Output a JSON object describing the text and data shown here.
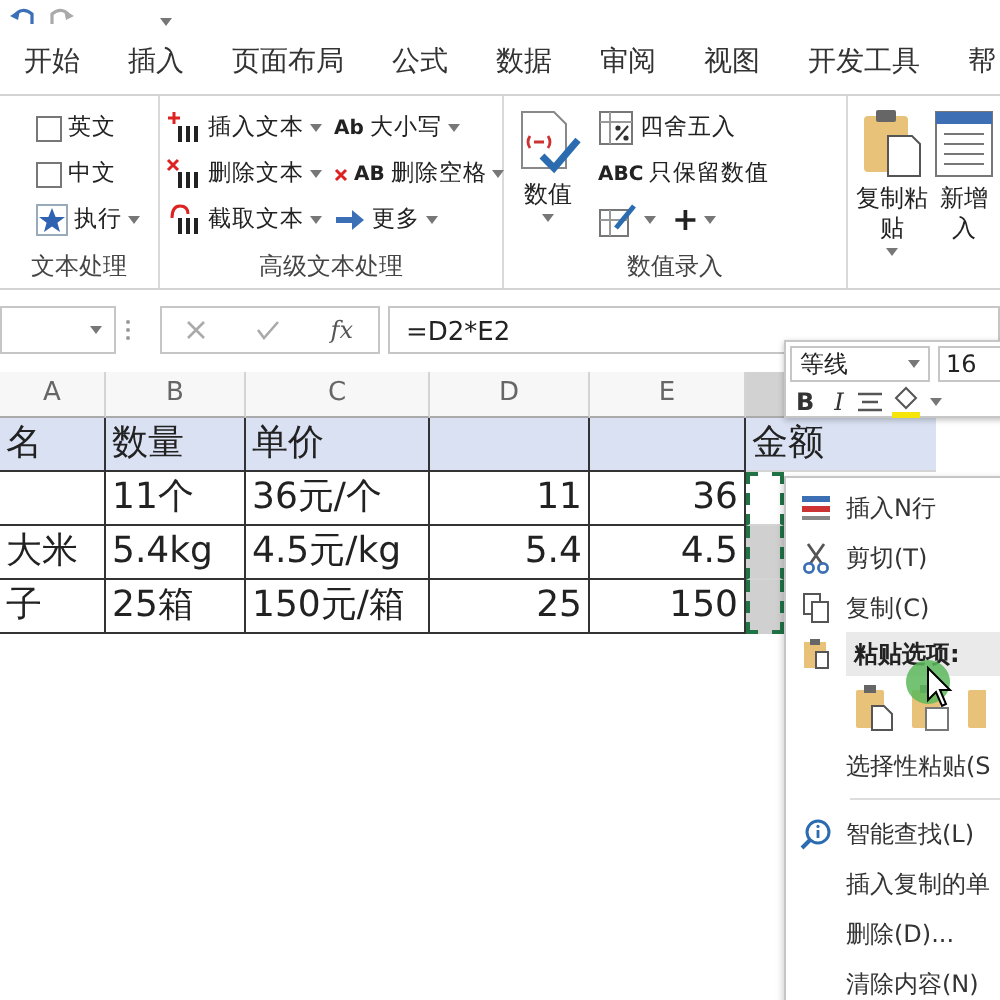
{
  "tabs": [
    {
      "label": "开始",
      "selected": false
    },
    {
      "label": "插入",
      "selected": false
    },
    {
      "label": "页面布局",
      "selected": false
    },
    {
      "label": "公式",
      "selected": false
    },
    {
      "label": "数据",
      "selected": false
    },
    {
      "label": "审阅",
      "selected": false
    },
    {
      "label": "视图",
      "selected": false
    },
    {
      "label": "开发工具",
      "selected": false
    },
    {
      "label": "帮",
      "selected": false
    }
  ],
  "ribbon_groups": [
    {
      "label": "文本处理",
      "columns": [
        [
          [
            {
              "kind": "checkbox",
              "label": "英文",
              "checked": false
            }
          ],
          [
            {
              "kind": "checkbox",
              "label": "中文",
              "checked": false
            }
          ],
          [
            {
              "kind": "button",
              "label": "执行",
              "dropdown": true
            }
          ]
        ]
      ]
    },
    {
      "label": "高级文本处理",
      "columns": [
        [
          [
            {
              "kind": "button",
              "label": "插入文本",
              "dropdown": true
            }
          ],
          [
            {
              "kind": "button",
              "label": "删除文本",
              "dropdown": true
            }
          ],
          [
            {
              "kind": "button",
              "label": "截取文本",
              "dropdown": true
            }
          ]
        ],
        [
          [
            {
              "kind": "button",
              "glyph": "Ab",
              "label": "大小写",
              "dropdown": true
            }
          ],
          [
            {
              "kind": "button",
              "glyph": "AB",
              "label": "删除空格",
              "dropdown": true
            }
          ],
          [
            {
              "kind": "button",
              "label": "更多",
              "dropdown": true
            }
          ]
        ]
      ]
    },
    {
      "label": "数值录入",
      "columns": [
        [
          [
            {
              "kind": "large",
              "label": "数值",
              "dropdown": true
            }
          ]
        ],
        [
          [
            {
              "kind": "button",
              "label": "四舍五入",
              "dropdown": false
            }
          ],
          [
            {
              "kind": "button",
              "glyph": "ABC",
              "label": "只保留数值",
              "dropdown": false
            }
          ],
          [
            {
              "kind": "button",
              "dropdown": true
            },
            {
              "kind": "button",
              "label": "+",
              "dropdown": true
            }
          ]
        ]
      ]
    },
    {
      "columns": [
        [
          [
            {
              "kind": "large",
              "label": "复制粘贴",
              "dropdown": true
            }
          ]
        ],
        [
          [
            {
              "kind": "large",
              "label": "新增入",
              "dropdown": false
            }
          ]
        ]
      ]
    }
  ],
  "formula_bar": {
    "function_label": "fx",
    "formula": "=D2*E2"
  },
  "sheet": {
    "columns": [
      {
        "label": "A",
        "selected": false
      },
      {
        "label": "B",
        "selected": false
      },
      {
        "label": "C",
        "selected": false
      },
      {
        "label": "D",
        "selected": false
      },
      {
        "label": "E",
        "selected": false
      },
      {
        "selected": true
      }
    ],
    "rows": [
      {
        "kind": "header",
        "cells": [
          "名",
          "数量",
          "单价",
          null,
          null,
          "金额"
        ],
        "selected": false
      },
      {
        "kind": "data",
        "cells": [
          null,
          "11个",
          "36元/个",
          "11",
          "36",
          null
        ],
        "selected": false
      },
      {
        "kind": "data",
        "cells": [
          "大米",
          "5.4kg",
          "4.5元/kg",
          "5.4",
          "4.5",
          null
        ],
        "selected": true
      },
      {
        "kind": "data",
        "cells": [
          "子",
          "25箱",
          "150元/箱",
          "25",
          "150",
          null
        ],
        "selected": true
      }
    ],
    "copy_range": true
  },
  "mini_toolbar": {
    "font": "等线",
    "size": "16",
    "bold": "B",
    "italic": "I"
  },
  "context_menu": [
    {
      "kind": "item",
      "label": "插入N行"
    },
    {
      "kind": "item",
      "label": "剪切(T)"
    },
    {
      "kind": "item",
      "label": "复制(C)"
    },
    {
      "kind": "header",
      "label": "粘贴选项:"
    },
    {
      "kind": "paste_options"
    },
    {
      "kind": "item",
      "label": "选择性粘贴(S"
    },
    {
      "kind": "separator"
    },
    {
      "kind": "item",
      "label": "智能查找(L)"
    },
    {
      "kind": "item",
      "label": "插入复制的单"
    },
    {
      "kind": "item",
      "label": "删除(D)..."
    },
    {
      "kind": "item",
      "label": "清除内容(N)"
    }
  ]
}
